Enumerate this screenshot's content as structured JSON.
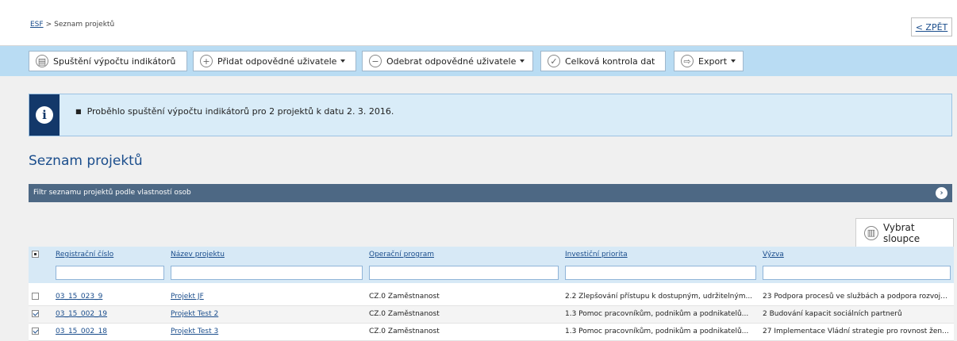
{
  "breadcrumb": {
    "root": "ESF",
    "separator": ">",
    "current": "Seznam projektů"
  },
  "back_label": "< ZPĚT",
  "toolbar": {
    "calc_label": "Spuštění výpočtu indikátorů",
    "add_users_label": "Přidat odpovědné uživatele",
    "remove_users_label": "Odebrat odpovědné uživatele",
    "check_data_label": "Celková kontrola dat",
    "export_label": "Export"
  },
  "message": {
    "text": "Proběhlo spuštění výpočtu indikátorů pro 2 projektů k datu 2. 3. 2016."
  },
  "section_title": "Seznam projektů",
  "filter_bar": {
    "label": "Filtr seznamu projektů podle vlastností osob"
  },
  "columns_button": "Vybrat sloupce",
  "table": {
    "headers": [
      "Registrační číslo",
      "Název projektu",
      "Operační program",
      "Investiční priorita",
      "Výzva"
    ],
    "rows": [
      {
        "checked": false,
        "reg": "03_15_023_9",
        "name": "Projekt JF",
        "program": "CZ.0 Zaměstnanost",
        "priority": "2.2 Zlepšování přístupu k dostupným, udržitelným...",
        "call": "23 Podpora procesů ve službách a podpora rozvoje..."
      },
      {
        "checked": true,
        "reg": "03_15_002_19",
        "name": "Projekt Test 2",
        "program": "CZ.0 Zaměstnanost",
        "priority": "1.3 Pomoc pracovníkům, podnikům a podnikatelů...",
        "call": "2 Budování kapacit sociálních partnerů"
      },
      {
        "checked": true,
        "reg": "03_15_002_18",
        "name": "Projekt Test 3",
        "program": "CZ.0 Zaměstnanost",
        "priority": "1.3 Pomoc pracovníkům, podnikům a podnikatelů...",
        "call": "27 Implementace Vládní strategie pro rovnost žen..."
      }
    ]
  },
  "colors": {
    "toolbar_bg": "#b9dcf3",
    "message_bg": "#d9ecf8",
    "message_icon_bg": "#13386a",
    "filter_bar_bg": "#4d6884",
    "link": "#1a4d8c",
    "table_header_bg": "#d7e9f6"
  },
  "icons": [
    "calculator-icon",
    "plus-circle-icon",
    "minus-circle-icon",
    "check-circle-icon",
    "export-icon",
    "info-icon",
    "arrow-right-icon",
    "columns-icon"
  ]
}
